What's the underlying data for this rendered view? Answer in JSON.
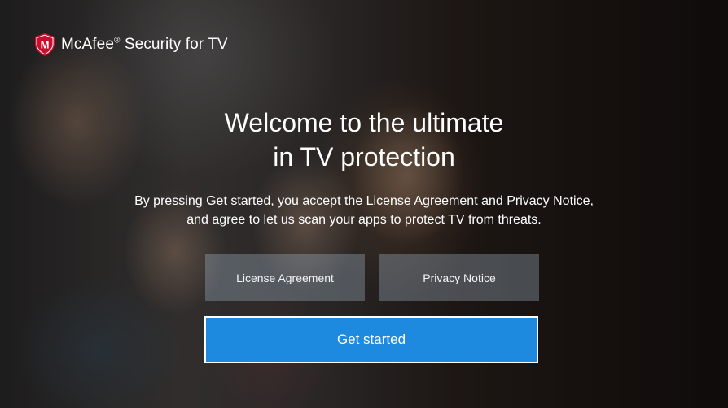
{
  "app": {
    "brand_name": "McAfee",
    "brand_mark": "®",
    "brand_suffix": "Security for TV",
    "logo_icon": "mcafee-shield-logo",
    "logo_letter": "M",
    "logo_color": "#c8102e"
  },
  "welcome": {
    "headline_line1": "Welcome to the ultimate",
    "headline_line2": "in TV protection",
    "notice_line1": "By pressing Get started, you accept the License Agreement and Privacy Notice,",
    "notice_line2": "and agree to let us scan your apps to protect TV from threats."
  },
  "buttons": {
    "license_label": "License Agreement",
    "privacy_label": "Privacy Notice",
    "get_started_label": "Get started"
  },
  "colors": {
    "primary_button": "#1d8ae0",
    "secondary_button": "rgba(175,195,215,0.32)",
    "text": "#ffffff"
  }
}
